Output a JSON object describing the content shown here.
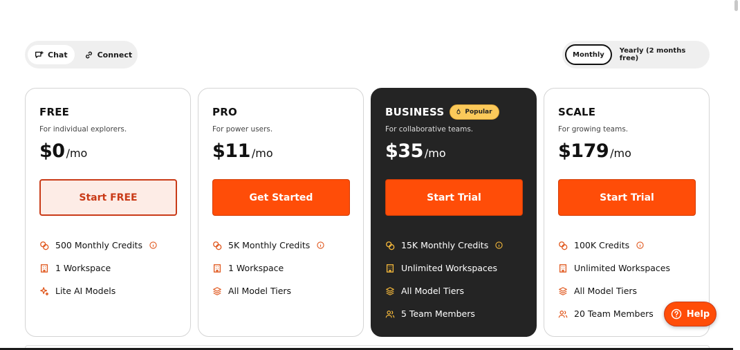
{
  "mode_toggle": {
    "chat_label": "Chat",
    "connect_label": "Connect",
    "active": "chat"
  },
  "billing_toggle": {
    "monthly_label": "Monthly",
    "yearly_label": "Yearly (2 months free)",
    "active": "monthly"
  },
  "colors": {
    "accent": "#ff4d08",
    "dark_card": "#242424",
    "badge": "#fbc95a"
  },
  "plans": [
    {
      "name": "FREE",
      "subtitle": "For individual explorers.",
      "price": "$0",
      "unit": "/mo",
      "cta": "Start FREE",
      "features": [
        "500 Monthly Credits",
        "1 Workspace",
        "Lite AI Models"
      ]
    },
    {
      "name": "PRO",
      "subtitle": "For power users.",
      "price": "$11",
      "unit": "/mo",
      "cta": "Get Started",
      "features": [
        "5K Monthly Credits",
        "1 Workspace",
        "All Model Tiers"
      ]
    },
    {
      "name": "BUSINESS",
      "badge": "Popular",
      "subtitle": "For collaborative teams.",
      "price": "$35",
      "unit": "/mo",
      "cta": "Start Trial",
      "features": [
        "15K Monthly Credits",
        "Unlimited Workspaces",
        "All Model Tiers",
        "5 Team Members"
      ]
    },
    {
      "name": "SCALE",
      "subtitle": "For growing teams.",
      "price": "$179",
      "unit": "/mo",
      "cta": "Start Trial",
      "features": [
        "100K Credits",
        "Unlimited Workspaces",
        "All Model Tiers",
        "20 Team Members"
      ]
    }
  ],
  "help": {
    "label": "Help"
  }
}
